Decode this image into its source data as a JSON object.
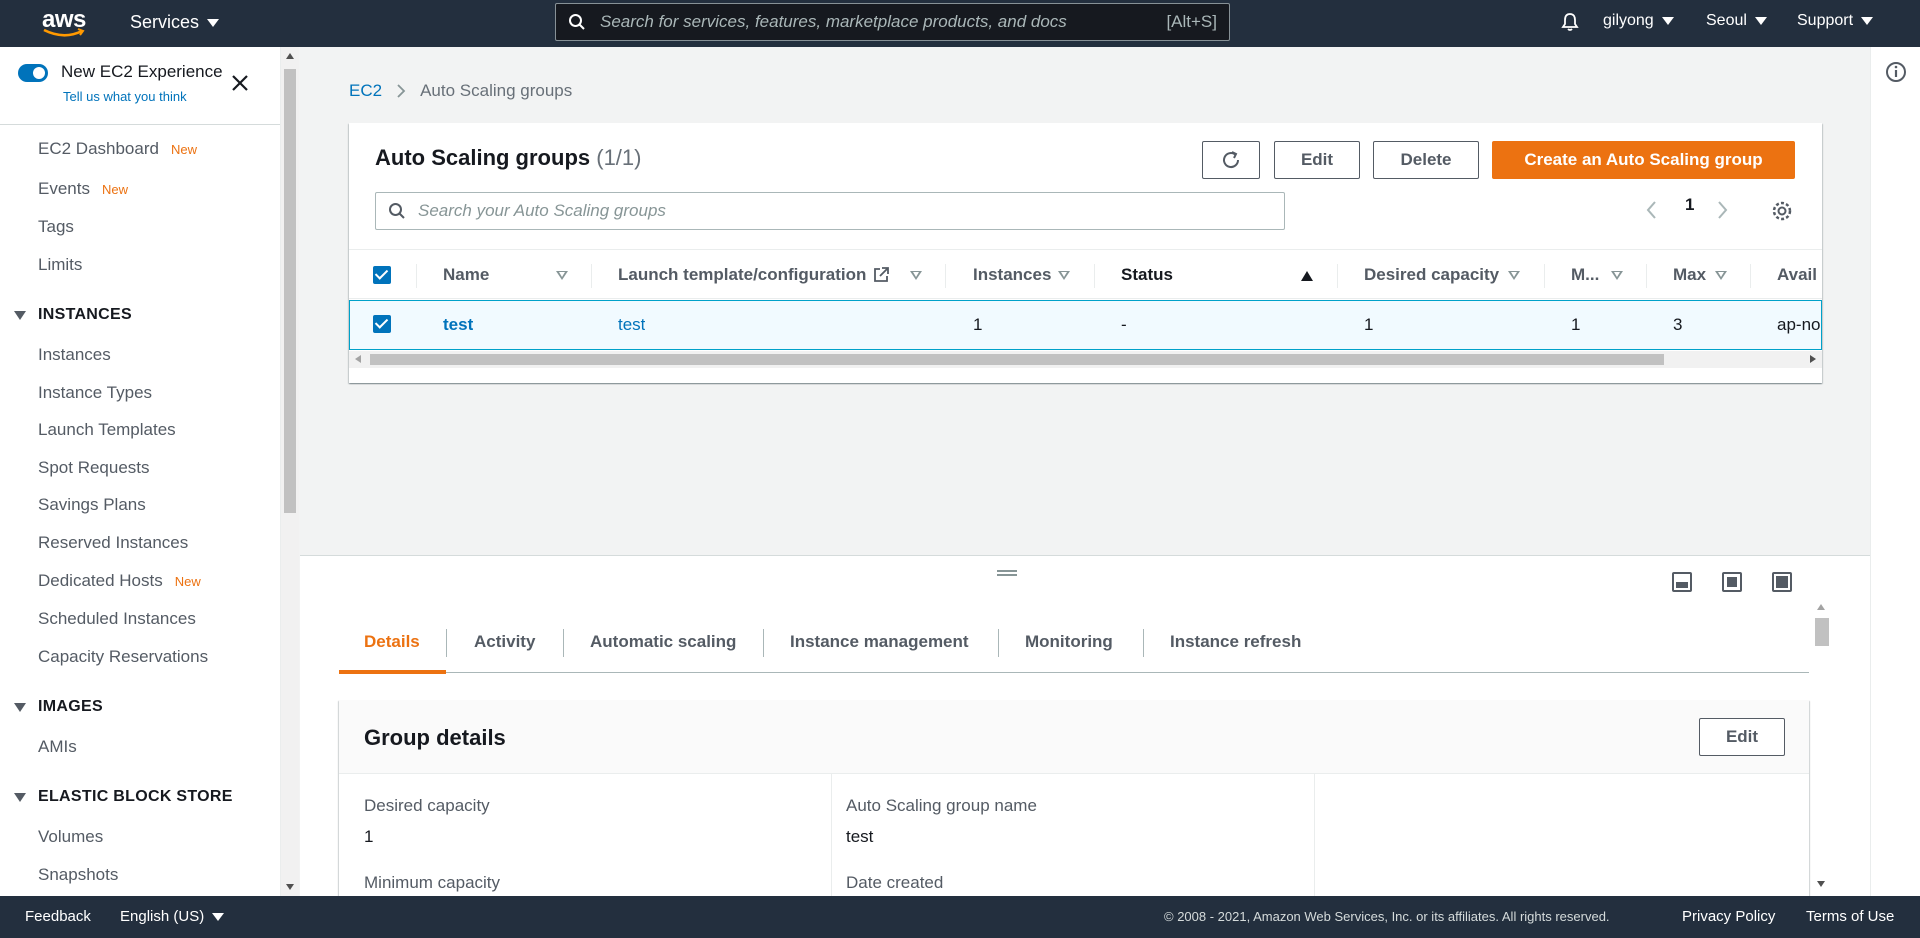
{
  "topnav": {
    "logo_text": "aws",
    "services_label": "Services",
    "search_placeholder": "Search for services, features, marketplace products, and docs",
    "search_shortcut": "[Alt+S]",
    "user_label": "gilyong",
    "region_label": "Seoul",
    "support_label": "Support"
  },
  "sidebar": {
    "new_experience_label": "New EC2 Experience",
    "feedback_link": "Tell us what you think",
    "new_badge": "New",
    "items_top": [
      {
        "label": "EC2 Dashboard",
        "new": true
      },
      {
        "label": "Events",
        "new": true
      },
      {
        "label": "Tags",
        "new": false
      },
      {
        "label": "Limits",
        "new": false
      }
    ],
    "sections": [
      {
        "title": "INSTANCES",
        "items": [
          "Instances",
          "Instance Types",
          "Launch Templates",
          "Spot Requests",
          "Savings Plans",
          "Reserved Instances",
          "Dedicated Hosts",
          "Scheduled Instances",
          "Capacity Reservations"
        ]
      },
      {
        "title": "IMAGES",
        "items": [
          "AMIs"
        ]
      },
      {
        "title": "ELASTIC BLOCK STORE",
        "items": [
          "Volumes",
          "Snapshots"
        ]
      }
    ]
  },
  "breadcrumb": {
    "root": "EC2",
    "current": "Auto Scaling groups"
  },
  "asg_panel": {
    "title": "Auto Scaling groups",
    "count": "(1/1)",
    "edit_button": "Edit",
    "delete_button": "Delete",
    "create_button": "Create an Auto Scaling group",
    "search_placeholder": "Search your Auto Scaling groups",
    "current_page": "1",
    "columns": [
      "Name",
      "Launch template/configuration",
      "Instances",
      "Status",
      "Desired capacity",
      "M...",
      "Max",
      "Avail"
    ],
    "rows": [
      {
        "selected": true,
        "name": "test",
        "launch_template": "test",
        "instances": "1",
        "status": "-",
        "desired_capacity": "1",
        "min": "1",
        "max": "3",
        "availability": "ap-no"
      }
    ]
  },
  "split_panel": {
    "tabs": [
      "Details",
      "Activity",
      "Automatic scaling",
      "Instance management",
      "Monitoring",
      "Instance refresh"
    ],
    "active_tab": "Details",
    "group_details": {
      "title": "Group details",
      "edit_button": "Edit",
      "fields": [
        {
          "label": "Desired capacity",
          "value": "1"
        },
        {
          "label": "Auto Scaling group name",
          "value": "test"
        },
        {
          "label": "Minimum capacity",
          "value": ""
        },
        {
          "label": "Date created",
          "value": ""
        }
      ]
    }
  },
  "footer": {
    "feedback": "Feedback",
    "language": "English (US)",
    "copyright": "© 2008 - 2021, Amazon Web Services, Inc. or its affiliates. All rights reserved.",
    "privacy": "Privacy Policy",
    "terms": "Terms of Use"
  },
  "colors": {
    "nav_bg": "#232f3e",
    "accent_orange": "#ec7211",
    "link_blue": "#0073bb"
  },
  "icons": [
    "search-icon",
    "bell-icon",
    "close-icon",
    "refresh-icon",
    "settings-icon",
    "external-link-icon",
    "info-icon",
    "sort-icon",
    "layout-icon"
  ]
}
